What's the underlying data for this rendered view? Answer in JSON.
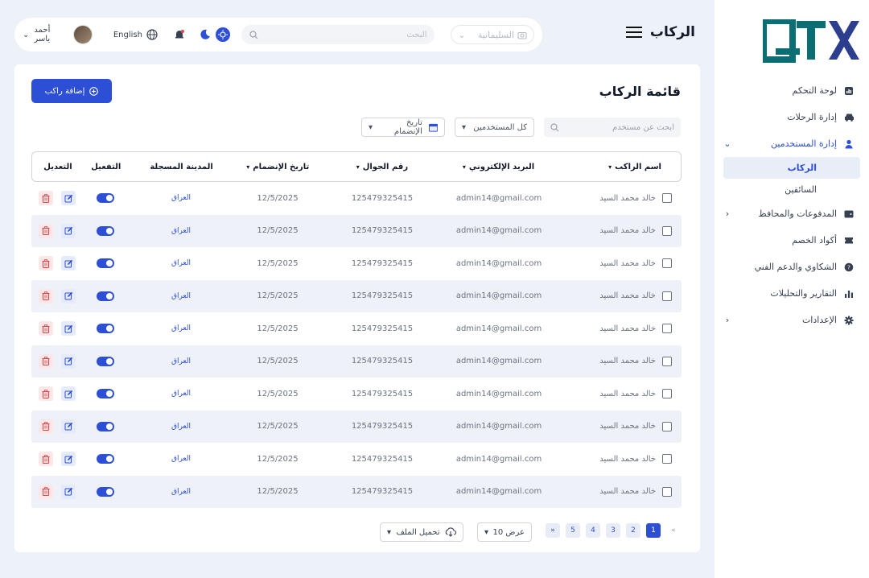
{
  "brand": {
    "logo_text": "QTX",
    "color": "#0c6e75"
  },
  "sidebar": {
    "items": [
      {
        "label": "لوحة التحكم",
        "icon": "dashboard-icon"
      },
      {
        "label": "إدارة الرحلات",
        "icon": "car-icon"
      },
      {
        "label": "إدارة المستخدمين",
        "icon": "user-icon",
        "active": true
      },
      {
        "label": "المدفوعات والمحافظ",
        "icon": "wallet-icon"
      },
      {
        "label": "أكواد الخصم",
        "icon": "ticket-icon"
      },
      {
        "label": "الشكاوي والدعم الفني",
        "icon": "support-icon"
      },
      {
        "label": "التقارير والتحليلات",
        "icon": "chart-icon"
      },
      {
        "label": "الإعدادات",
        "icon": "gear-icon"
      }
    ],
    "sub_items": [
      {
        "label": "الركاب",
        "active": true
      },
      {
        "label": "السائقين"
      }
    ]
  },
  "header": {
    "page_title": "الركاب",
    "city_select": "السليمانية",
    "search_placeholder": "البحث",
    "language": "English",
    "user_name": "أحمد ياسر"
  },
  "main": {
    "title": "قائمة الركاب",
    "add_button": "إضافة راكب",
    "filters": {
      "search_placeholder": "ابحث عن مستخدم",
      "users_select": "كل المستخدمين",
      "date_select": "تاريخ الإنضمام"
    },
    "columns": [
      "اسم الراكب",
      "البريد الإلكتروني",
      "رقم الجوال",
      "تاريخ الإنضمام",
      "المدينة المسجلة",
      "التفعيل",
      "التعديل"
    ],
    "rows": [
      {
        "name": "خالد محمد السيد",
        "email": "admin14@gmail.com",
        "phone": "125479325415",
        "date": "12/5/2025",
        "city": "العراق",
        "active": true
      },
      {
        "name": "خالد محمد السيد",
        "email": "admin14@gmail.com",
        "phone": "125479325415",
        "date": "12/5/2025",
        "city": "العراق",
        "active": true
      },
      {
        "name": "خالد محمد السيد",
        "email": "admin14@gmail.com",
        "phone": "125479325415",
        "date": "12/5/2025",
        "city": "العراق",
        "active": true
      },
      {
        "name": "خالد محمد السيد",
        "email": "admin14@gmail.com",
        "phone": "125479325415",
        "date": "12/5/2025",
        "city": "العراق",
        "active": true
      },
      {
        "name": "خالد محمد السيد",
        "email": "admin14@gmail.com",
        "phone": "125479325415",
        "date": "12/5/2025",
        "city": "العراق",
        "active": true
      },
      {
        "name": "خالد محمد السيد",
        "email": "admin14@gmail.com",
        "phone": "125479325415",
        "date": "12/5/2025",
        "city": "العراق",
        "active": true
      },
      {
        "name": "خالد محمد السيد",
        "email": "admin14@gmail.com",
        "phone": "125479325415",
        "date": "12/5/2025",
        "city": "العراق",
        "active": true
      },
      {
        "name": "خالد محمد السيد",
        "email": "admin14@gmail.com",
        "phone": "125479325415",
        "date": "12/5/2025",
        "city": "العراق",
        "active": true
      },
      {
        "name": "خالد محمد السيد",
        "email": "admin14@gmail.com",
        "phone": "125479325415",
        "date": "12/5/2025",
        "city": "العراق",
        "active": true
      },
      {
        "name": "خالد محمد السيد",
        "email": "admin14@gmail.com",
        "phone": "125479325415",
        "date": "12/5/2025",
        "city": "العراق",
        "active": true
      }
    ]
  },
  "pagination": {
    "pages": [
      "1",
      "2",
      "3",
      "4",
      "5"
    ],
    "current": "1",
    "per_page": "عرض 10",
    "download": "تحميل الملف"
  },
  "colors": {
    "accent": "#2d4fd6",
    "danger": "#e0454b",
    "background": "#edf1f8"
  }
}
